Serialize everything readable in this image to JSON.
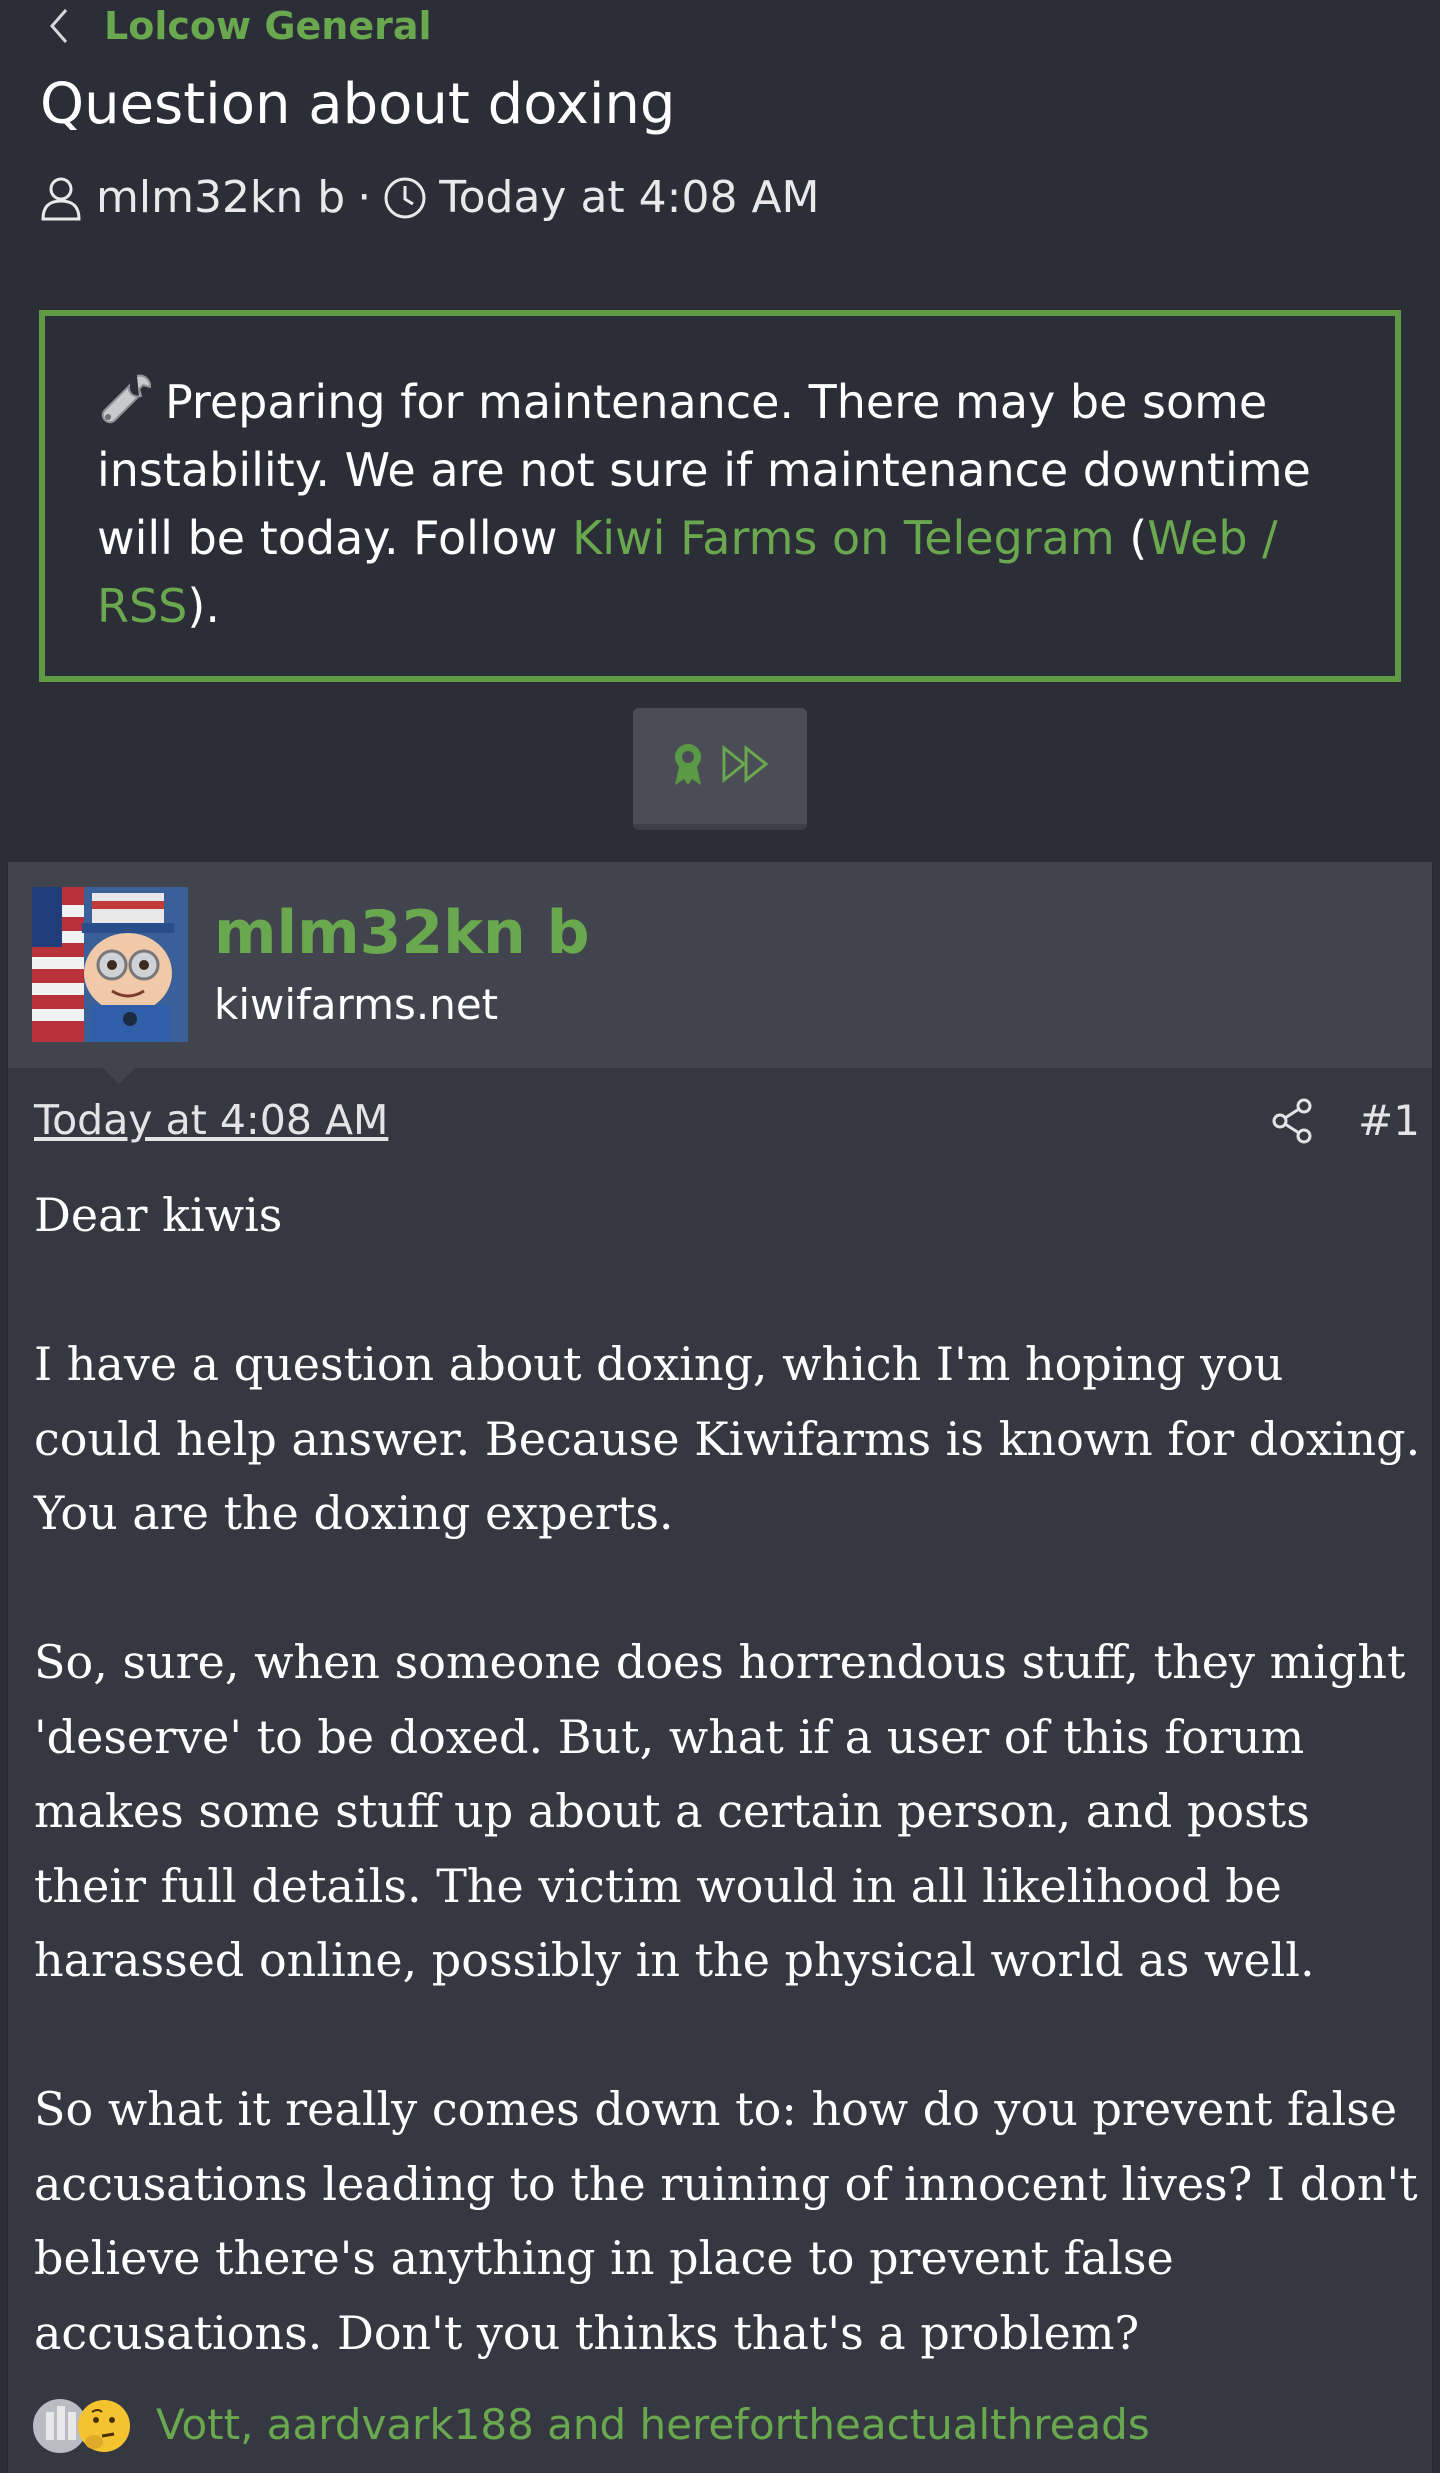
{
  "breadcrumb": {
    "label": "Lolcow General"
  },
  "thread": {
    "title": "Question about doxing",
    "author": "mlm32kn b",
    "separator": "·",
    "time": "Today at 4:08 AM"
  },
  "notice": {
    "text_before": "Preparing for maintenance. There may be some instability. We are not sure if maintenance downtime will be today. Follow ",
    "link1": "Kiwi Farms on Telegram",
    "paren_open": " (",
    "link2": "Web / RSS",
    "text_after": ")."
  },
  "post": {
    "author_name": "mlm32kn b",
    "author_site": "kiwifarms.net",
    "date": "Today at 4:08 AM",
    "number": "#1",
    "body": "Dear kiwis\n\nI have a question about doxing, which I'm hoping you could help answer. Because Kiwifarms is known for doxing. You are the doxing experts.\n\nSo, sure, when someone does horrendous stuff, they might 'deserve' to be doxed. But, what if a user of this forum makes some stuff up about a certain person, and posts their full details. The victim would in all likelihood be harassed online, possibly in the physical world as well.\n\nSo what it really comes down to: how do you prevent false accusations leading to the ruining of innocent lives? I don't believe there's anything in place to prevent false accusations. Don't you thinks that's a problem?",
    "reactors": "Vott, aardvark188 and herefortheactualthreads"
  },
  "icons": {
    "back": "chevron-left-icon",
    "user": "user-icon",
    "clock": "clock-icon",
    "wrench": "wrench-icon",
    "award": "award-icon",
    "forward": "fast-forward-icon",
    "share": "share-icon",
    "reaction1": "reaction-icon",
    "reaction2": "thinking-face-icon"
  },
  "colors": {
    "background": "#2b2e36",
    "accent_green": "#6aa84f",
    "notice_border": "#5f9a47",
    "post_bg": "#353841",
    "post_header_bg": "#41444d"
  }
}
